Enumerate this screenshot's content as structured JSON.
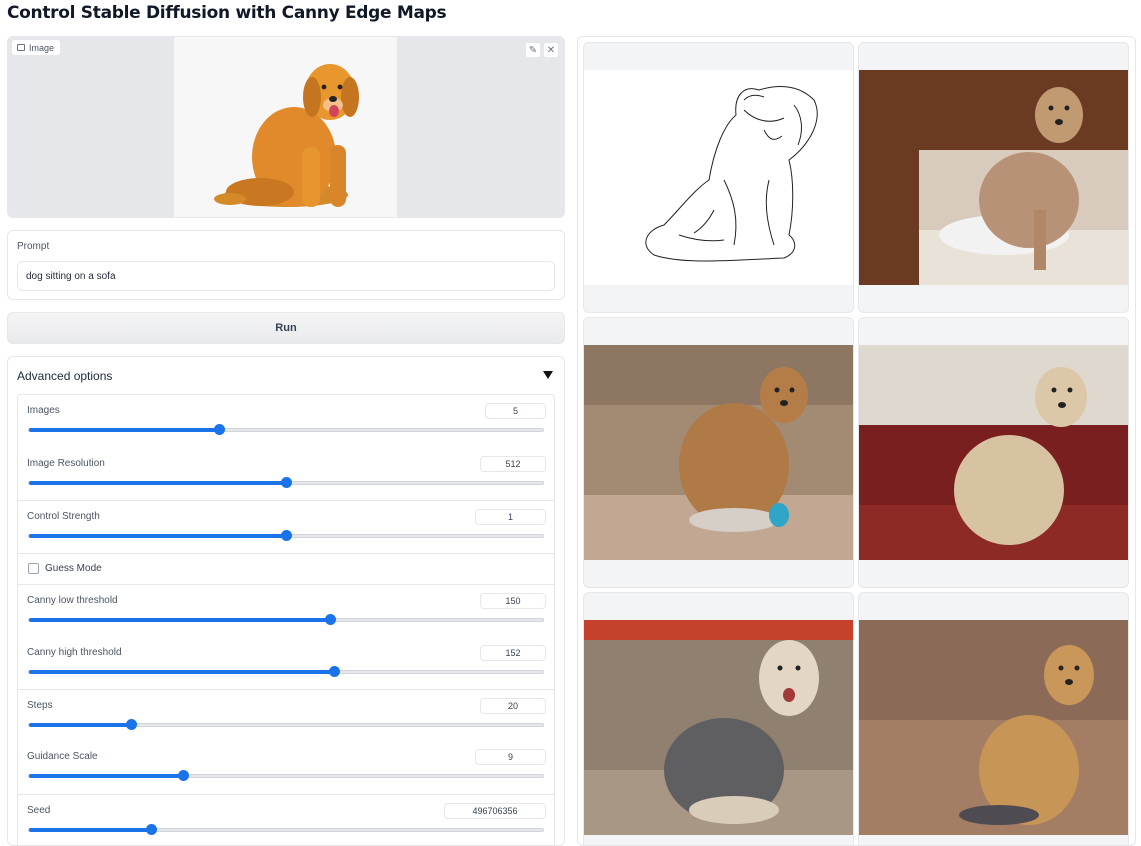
{
  "page": {
    "title": "Control Stable Diffusion with Canny Edge Maps"
  },
  "image_input": {
    "label": "Image",
    "edit_icon": "pencil-icon",
    "clear_icon": "close-icon"
  },
  "prompt": {
    "label": "Prompt",
    "value": "dog sitting on a sofa"
  },
  "run": {
    "label": "Run"
  },
  "advanced": {
    "label": "Advanced options",
    "expanded": true,
    "sliders": [
      {
        "label": "Images",
        "value": "5",
        "fraction": 0.37
      },
      {
        "label": "Image Resolution",
        "value": "512",
        "fraction": 0.5
      },
      {
        "label": "Control Strength",
        "value": "1",
        "fraction": 0.5
      },
      {
        "label": "Canny low threshold",
        "value": "150",
        "fraction": 0.585
      },
      {
        "label": "Canny high threshold",
        "value": "152",
        "fraction": 0.593
      },
      {
        "label": "Steps",
        "value": "20",
        "fraction": 0.198
      },
      {
        "label": "Guidance Scale",
        "value": "9",
        "fraction": 0.3
      },
      {
        "label": "Seed",
        "value": "496706356",
        "fraction": 0.237
      }
    ],
    "guess_mode": {
      "label": "Guess Mode",
      "checked": false
    }
  },
  "gallery": {
    "items": [
      {
        "alt": "canny edge map"
      },
      {
        "alt": "generated image 1"
      },
      {
        "alt": "generated image 2"
      },
      {
        "alt": "generated image 3"
      },
      {
        "alt": "generated image 4"
      },
      {
        "alt": "generated image 5"
      }
    ]
  },
  "colors": {
    "accent": "#1a73e8",
    "border": "#e5e7eb",
    "panel": "#e5e7eb"
  }
}
